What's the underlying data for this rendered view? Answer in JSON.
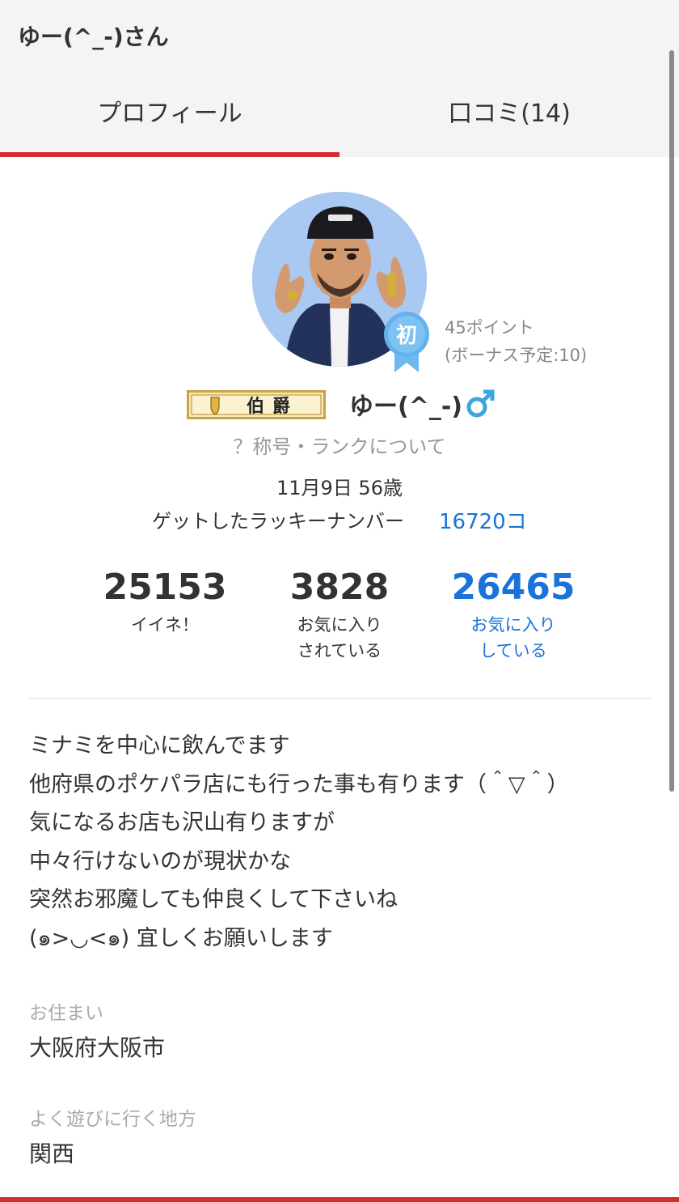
{
  "header": {
    "title": "ゆー(^_-)さん",
    "tabs": [
      {
        "label": "プロフィール",
        "active": true
      },
      {
        "label": "口コミ(14)",
        "active": false
      }
    ]
  },
  "profile": {
    "badge_label": "初",
    "points": "45ポイント",
    "bonus": "(ボーナス予定:10)",
    "rank_title": "伯爵",
    "username": "ゆー(^_-)",
    "gender_symbol": "♂",
    "rank_link": "？称号・ランクについて",
    "birthday_age": "11月9日 56歳",
    "lucky_label": "ゲットしたラッキーナンバー",
    "lucky_value": "16720コ"
  },
  "stats": [
    {
      "value": "25153",
      "label_line1": "イイネ！",
      "label_line2": ""
    },
    {
      "value": "3828",
      "label_line1": "お気に入り",
      "label_line2": "されている"
    },
    {
      "value": "26465",
      "label_line1": "お気に入り",
      "label_line2": "している"
    }
  ],
  "bio": [
    "ミナミを中心に飲んでます",
    "他府県のポケパラ店にも行った事も有ります（＾▽＾）",
    "気になるお店も沢山有りますが",
    "中々行けないのが現状かな",
    "突然お邪魔しても仲良くして下さいね",
    "(๑>◡<๑) 宜しくお願いします"
  ],
  "residence": {
    "label": "お住まい",
    "value": "大阪府大阪市"
  },
  "area": {
    "label": "よく遊びに行く地方",
    "value": "関西"
  },
  "colors": {
    "accent_red": "#d32f2f",
    "link_blue": "#1a73d9",
    "badge_blue": "#62b3ec"
  }
}
